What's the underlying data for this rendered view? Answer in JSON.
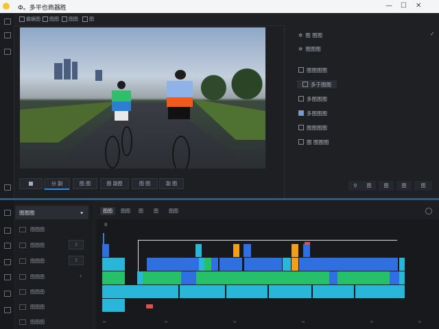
{
  "window": {
    "title": "Ф。多平也商器胜",
    "logo": "app-logo"
  },
  "topbar": {
    "items": [
      "霸据图",
      "图图",
      "图图",
      "图"
    ]
  },
  "preview": {
    "scene": "两名骑行者在公路上"
  },
  "controls": {
    "buttons": [
      "",
      "分 副",
      "图 图",
      "图 副图",
      "图 图",
      "副 图"
    ]
  },
  "right_panel": {
    "header": [
      "图 图图",
      "图图图"
    ],
    "items": [
      "图图图图",
      "多于图图",
      "多图图图",
      "多图图图",
      "图图图图",
      "图 图图图"
    ],
    "bottom_buttons": [
      "图",
      "图",
      "图",
      "图",
      "图"
    ]
  },
  "timeline": {
    "track_header": {
      "label": "图图图",
      "arrow": "▾"
    },
    "tracks": [
      "图图图",
      "图图图",
      "图图图",
      "图图图",
      "图图图",
      "图图图",
      "图图图"
    ],
    "tabs": [
      "图图",
      "图图",
      "图",
      "图",
      "图图"
    ],
    "ruler_label": "8"
  },
  "colors": {
    "accent": "#2e8de6",
    "clip_cyan": "#29b6d8",
    "clip_blue": "#2f6fe0",
    "clip_green": "#27c06a",
    "clip_orange": "#f2a01c",
    "clip_red": "#e05050"
  }
}
